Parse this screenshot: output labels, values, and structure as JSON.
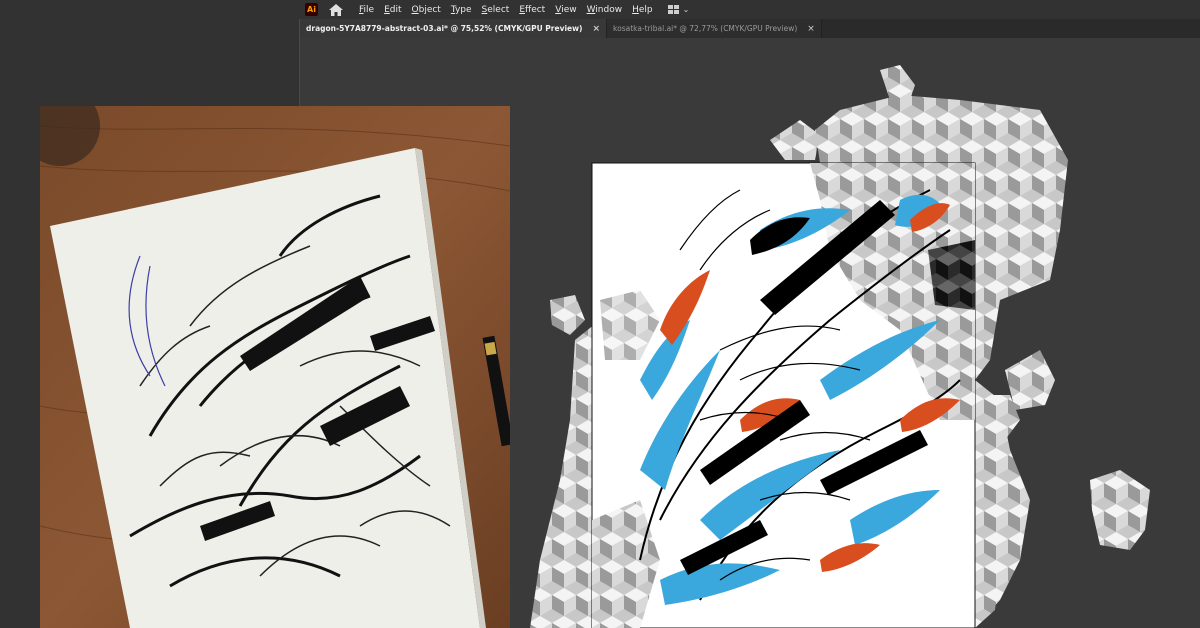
{
  "app": {
    "logo_text": "Ai",
    "icons": [
      "illustrator-logo-icon",
      "home-icon",
      "workspace-switcher-icon",
      "chevron-down-icon",
      "close-icon"
    ]
  },
  "menu": [
    "File",
    "Edit",
    "Object",
    "Type",
    "Select",
    "Effect",
    "View",
    "Window",
    "Help"
  ],
  "tabs": [
    {
      "label": "dragon-5Y7A8779-abstract-03.ai* @ 75,52% (CMYK/GPU Preview)",
      "close": "×",
      "active": true
    },
    {
      "label": "kosatka-tribal.ai* @ 72,77% (CMYK/GPU Preview)",
      "close": "×",
      "active": false
    }
  ],
  "colors": {
    "ui_dark": "#323232",
    "canvas": "#3a3a3a",
    "accent_blue": "#3aa7dd",
    "accent_orange": "#d94e1f"
  }
}
